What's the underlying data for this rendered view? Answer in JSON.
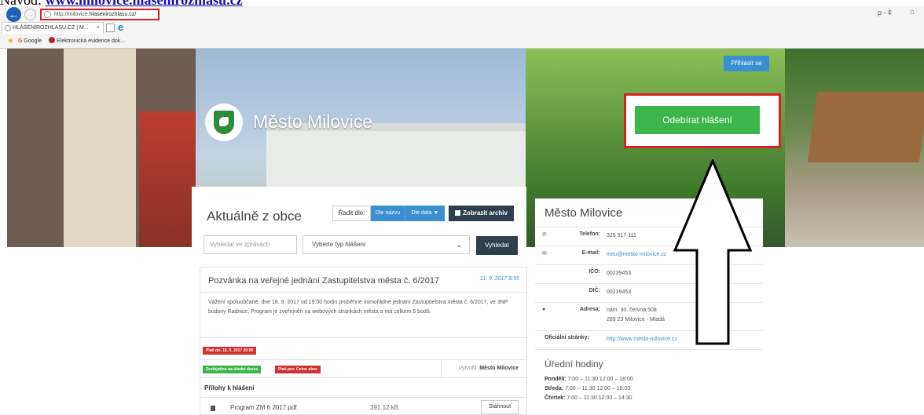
{
  "caption": {
    "prefix": "Návod: ",
    "link": "www.milovice.hlasenirozhlasu.cz"
  },
  "browser": {
    "url_prefix": "http://milovice.",
    "url_domain": "hlasenirozhlasu.cz/",
    "search_control": "ρ - ¢",
    "tab_title": "HLÁŠENÍROZHLASU.CZ | M...",
    "tab_close": "×",
    "favorites": [
      {
        "icon": "google-icon",
        "label": "Google"
      },
      {
        "icon": "site-icon",
        "label": "Elektronická evidence dok..."
      }
    ]
  },
  "hero": {
    "town_name": "Město Milovice",
    "login_label": "Přihlásit se",
    "subscribe_label": "Odebírat hlášení"
  },
  "news": {
    "title": "Aktuálně z obce",
    "sort_label": "Řadit dle:",
    "sort_by_name": "Dle názvu",
    "sort_by_date": "Dle data ▼",
    "archive_label": "Zobrazit archiv",
    "search_placeholder": "Vyhledat ve zprávách",
    "type_select_value": "Vyberte typ hlášení",
    "search_button": "Vyhledat",
    "article": {
      "title": "Pozvánka na veřejné jednání Zastupitelstva města č. 6/2017",
      "date": "11. 9. 2017 8:55",
      "body": "Vážení spoluobčané, dne 18. 9. 2017 od 19:00 hodin proběhne mimořádné jednání Zastupitelstva města č. 6/2017, ve 3NP budovy Radnice. Program je zveřejněn na webových stránkách města a má celkem 6 bodů.",
      "valid_until": "Platí do: 18. 9. 2017 20:00",
      "badge_board": "Zveřejněno na úřední desce",
      "badge_scope": "Platí pro: Celou obec",
      "created_label": "Vytvořil:",
      "created_by": "Město Milovice",
      "attachments_header": "Přílohy k hlášení",
      "attachment": {
        "name": "Program ZM 6 2017.pdf",
        "size": "391.12 kB",
        "download": "Stáhnout"
      }
    }
  },
  "info": {
    "title": "Město Milovice",
    "rows": {
      "phone": {
        "icon": "phone-icon",
        "label": "Telefon:",
        "value": "325 517 111"
      },
      "email": {
        "icon": "mail-icon",
        "label": "E-mail:",
        "value": "meu@mesto-milovice.cz"
      },
      "ico": {
        "label": "IČO:",
        "value": "00239453"
      },
      "dic": {
        "label": "DIČ:",
        "value": "00239453"
      },
      "address": {
        "icon": "map-pin-icon",
        "label": "Adresa:",
        "line1": "nám. 30. června 508",
        "line2": "289 23 Milovice - Mladá"
      }
    },
    "web_label": "Oficiální stránky:",
    "web_value": "http://www.mesto-milovice.cz",
    "hours_title": "Úřední hodiny",
    "hours": [
      {
        "day": "Pondělí:",
        "time": "7:00 – 11:30 12:00 – 18:00"
      },
      {
        "day": "Středa:",
        "time": "7:00 – 11:30 12:00 – 18:00"
      },
      {
        "day": "Čtvrtek:",
        "time": "7:00 – 11:30 12:00 – 14:30"
      }
    ]
  },
  "colors": {
    "accent_blue": "#3a8fd1",
    "subscribe_green": "#3cb64a",
    "dark_button": "#2f3e4d",
    "badge_red": "#d42f2f",
    "highlight_red": "#d9201f"
  }
}
